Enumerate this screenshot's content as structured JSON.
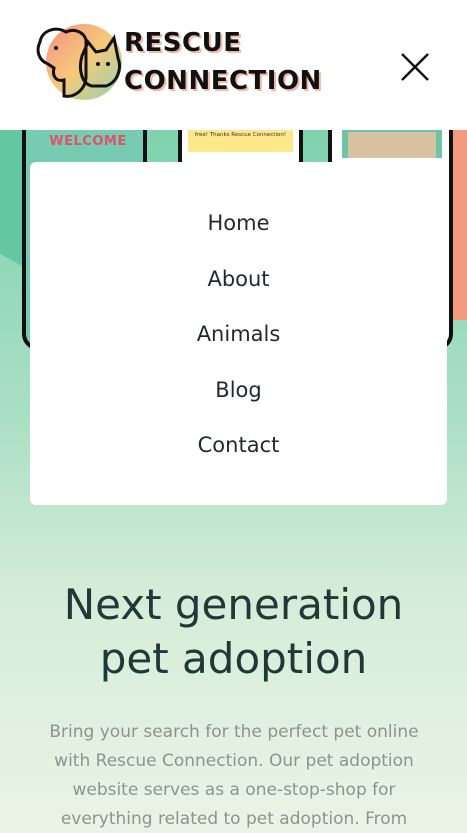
{
  "header": {
    "brand_line1": "RESCUE",
    "brand_line2": "CONNECTION",
    "logo_icon": "dog-cat-logo-icon",
    "close_icon": "close-icon"
  },
  "hero_images": {
    "welcome_text": "WELCOME",
    "review_text": "amazing little girl and the process to adopt was efficient and stress free! Thanks Rescue Connection!"
  },
  "nav": {
    "items": [
      {
        "label": "Home"
      },
      {
        "label": "About"
      },
      {
        "label": "Animals"
      },
      {
        "label": "Blog"
      },
      {
        "label": "Contact"
      }
    ]
  },
  "hero": {
    "headline_line1": "Next generation",
    "headline_line2": "pet adoption",
    "lead": "Bring your search for the perfect pet online with Rescue Connection. Our pet adoption website serves as a one-stop-shop for everything related to pet adoption. From"
  },
  "colors": {
    "brand_text": "#111111",
    "accent_coral": "#f49a7e",
    "accent_mint": "#7fd2ae",
    "heading": "#1f3a36",
    "muted_text": "#8a958f"
  }
}
